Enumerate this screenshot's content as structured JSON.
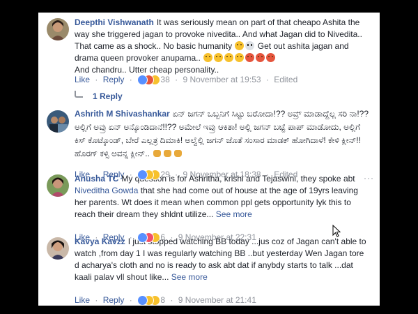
{
  "comments": [
    {
      "author": "Deepthi Vishwanath",
      "text_1": "It was seriously mean on part of that cheapo Ashita the way she triggered jagan to provoke nivedita.. And what Jagan did to Nivedita.. That came as a shock.. No basic humanity",
      "text_2": "Get out ashita jagan and drama queen provoker anupama..",
      "text_3": "And chandru.. Utter cheap personality..",
      "like": "Like",
      "reply": "Reply",
      "reaction_count": "38",
      "timestamp": "9 November at 19:53",
      "edited": "Edited",
      "reply_count_label": "1 Reply"
    },
    {
      "author": "Ashrith M Shivashankar",
      "text_1": "ಏನ್ ಜಗನ್ ಒಬ್ಬನಿಗೆ ಸಿಟ್ಟು ಬರೋದಾ!?? ಅವ್ರ್ ಮಾಡಾದ್ದೆಲ್ಲ ಸರಿ ನಾ!?? ಅಲ್ಲಿಗೆ ಅವ್ರು ಏನ್ ಅನ್ಕೊಂಡಿದಾನೆ!!?? ಅಮೇಲೆ ಇವ್ರು ಆಕಿತಾ! ಅಲ್ಲಿ ಜಗನ್ ಬಟ್ಟೆ ಪಾಪ್ ಮಾಡೋದು, ಅಲ್ಲಿಗೆ ಕಿಸ್ ಕೊಟ್ಕೊಂಡ್, ಬೇರೆ ಎಲ್ಲತ್ರ ದಿಮಾಕಿ! ಅಲ್ವೆಲ್ಲಿ ಜಗನ್ ಜೊತೆ ಸಂಸಾರ ಮಾಡಕ್ ಹೋಗಿದಾಳೆ! ಕೇಳಿ ಕ್ಲೀನ್!! ಹೊರಗ್ ಕಳ್ಸಿ ಅವನ್ನ ಕ್ಲೀನ್..",
      "like": "Like",
      "reply": "Reply",
      "reaction_count": "29",
      "timestamp": "9 November at 18:38",
      "edited": "Edited"
    },
    {
      "author": "Anusha TC",
      "text_1": "My question is for Ashritha, krishi and Tejaswini, they spoke abt",
      "mention": "Niveditha Gowda",
      "text_2": "that she had come out of house at the age of 19yrs leaving her parents. Wt does it mean when common ppl gets opportunity lyk this to reach their dream they shldnt utilize...",
      "see_more": "See more",
      "like": "Like",
      "reply": "Reply",
      "reaction_count": "6",
      "timestamp": "9 November at 22:31"
    },
    {
      "author": "Kavya Kavzz",
      "text_1": "I just stopped watching BB today ...jus coz of Jagan can't able to watch ,from day 1 I was regularly watching BB ..but yesterday Wen Jagan tore d acharya's cloth and no is ready to ask abt dat if anybdy starts to talk ...dat kaali palav vll shout like...",
      "see_more": "See more",
      "like": "Like",
      "reply": "Reply",
      "reaction_count": "8",
      "timestamp": "9 November at 21:41"
    }
  ],
  "options_glyph": "···",
  "separator": "·"
}
